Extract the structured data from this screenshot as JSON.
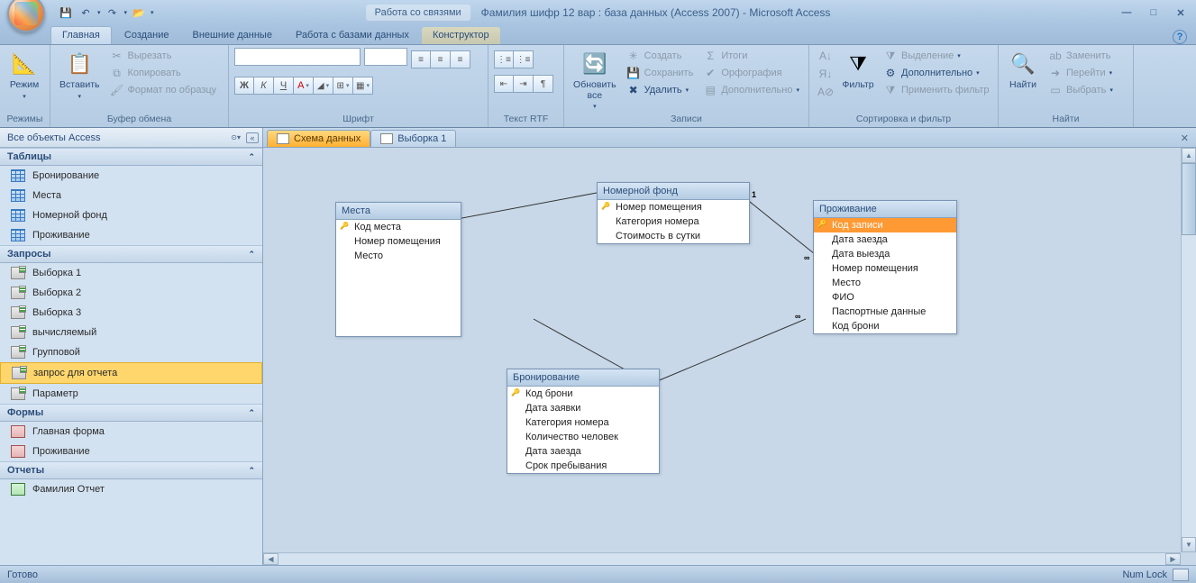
{
  "title": "Фамилия шифр 12 вар : база данных (Access 2007) - Microsoft Access",
  "contextual_tab_group": "Работа со связями",
  "tabs": {
    "home": "Главная",
    "create": "Создание",
    "external": "Внешние данные",
    "dbtools": "Работа с базами данных",
    "design": "Конструктор"
  },
  "ribbon": {
    "groups": {
      "views": "Режимы",
      "clipboard": "Буфер обмена",
      "font": "Шрифт",
      "richtext": "Текст RTF",
      "records": "Записи",
      "sortfilter": "Сортировка и фильтр",
      "find": "Найти"
    },
    "view": "Режим",
    "paste": "Вставить",
    "cut": "Вырезать",
    "copy": "Копировать",
    "painter": "Формат по образцу",
    "refresh": "Обновить все",
    "new": "Создать",
    "save": "Сохранить",
    "delete": "Удалить",
    "totals": "Итоги",
    "spelling": "Орфография",
    "more": "Дополнительно",
    "filter": "Фильтр",
    "selection": "Выделение",
    "advanced": "Дополнительно",
    "toggle": "Применить фильтр",
    "find_btn": "Найти",
    "replace": "Заменить",
    "goto": "Перейти",
    "select": "Выбрать"
  },
  "nav": {
    "header": "Все объекты Access",
    "groups": {
      "tables": "Таблицы",
      "queries": "Запросы",
      "forms": "Формы",
      "reports": "Отчеты"
    },
    "tables": [
      "Бронирование",
      "Места",
      "Номерной фонд",
      "Проживание"
    ],
    "queries": [
      "Выборка 1",
      "Выборка 2",
      "Выборка 3",
      "вычисляемый",
      "Групповой",
      "запрос для отчета",
      "Параметр"
    ],
    "forms": [
      "Главная форма",
      "Проживание"
    ],
    "reports": [
      "Фамилия Отчет"
    ]
  },
  "doc_tabs": {
    "schema": "Схема данных",
    "query1": "Выборка 1"
  },
  "rel": {
    "places": {
      "title": "Места",
      "fields": [
        "Код места",
        "Номер помещения",
        "Место"
      ]
    },
    "rooms": {
      "title": "Номерной фонд",
      "fields": [
        "Номер помещения",
        "Категория номера",
        "Стоимость в сутки"
      ]
    },
    "stay": {
      "title": "Проживание",
      "fields": [
        "Код записи",
        "Дата заезда",
        "Дата выезда",
        "Номер помещения",
        "Место",
        "ФИО",
        "Паспортные данные",
        "Код брони"
      ]
    },
    "booking": {
      "title": "Бронирование",
      "fields": [
        "Код брони",
        "Дата заявки",
        "Категория номера",
        "Количество человек",
        "Дата заезда",
        "Срок пребывания"
      ]
    }
  },
  "status": {
    "ready": "Готово",
    "numlock": "Num Lock"
  }
}
